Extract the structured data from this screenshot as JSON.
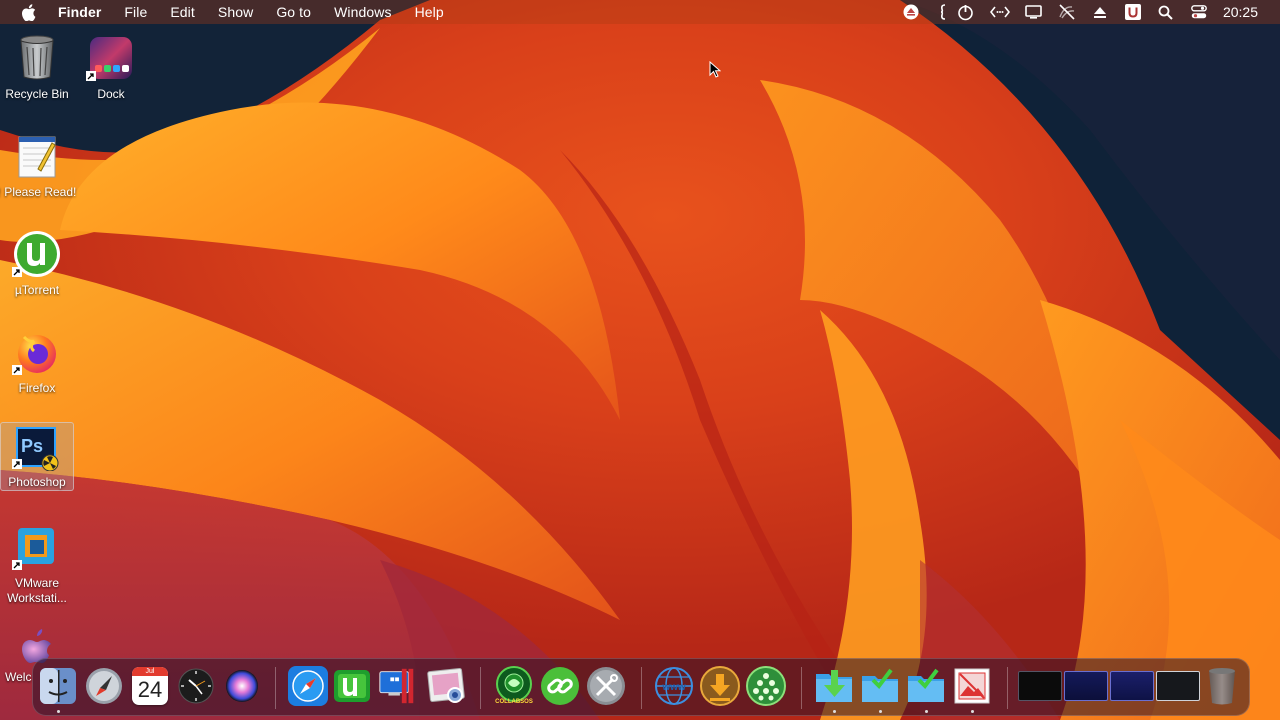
{
  "menubar": {
    "app_name": "Finder",
    "menus": [
      "File",
      "Edit",
      "Show",
      "Go to",
      "Windows",
      "Help"
    ],
    "status_icons": [
      "eject-circle-icon",
      "s-bracket-icon",
      "power-icon",
      "code-arrows-icon",
      "display-icon",
      "muted-icon",
      "eject-icon",
      "u-icon",
      "search-icon",
      "control-center-icon"
    ],
    "clock": "20:25"
  },
  "desktop": {
    "icons": [
      {
        "label": "Recycle Bin",
        "icon": "trash-icon"
      },
      {
        "label": "Dock",
        "icon": "dock-icon"
      },
      {
        "label": "! Please Read!",
        "icon": "notepad-icon"
      },
      {
        "label": "µTorrent",
        "icon": "utorrent-icon"
      },
      {
        "label": "Firefox",
        "icon": "firefox-icon"
      },
      {
        "label": "Photoshop",
        "icon": "photoshop-icon"
      },
      {
        "label": "VMware Workstati...",
        "icon": "vmware-icon"
      },
      {
        "label": "Welc",
        "icon": "apple-welcome-icon"
      }
    ],
    "selected": "Photoshop"
  },
  "dock": {
    "items": [
      "finder-icon",
      "launchpad-icon",
      "calendar-icon",
      "clock-icon",
      "siri-icon",
      "safari-icon",
      "utorrent-icon",
      "parallels-icon",
      "preview-icon",
      "collabsos-icon",
      "link-icon",
      "tools-icon",
      "www-icon",
      "download-icon",
      "cluster-icon",
      "downloads-folder-icon",
      "folder-check-icon",
      "folder-check-2-icon",
      "image-icon",
      "window-thumb-1",
      "window-thumb-2",
      "window-thumb-3",
      "window-thumb-4",
      "trash-icon"
    ],
    "calendar": {
      "month": "Jul",
      "day": "24"
    },
    "collabsos_text": "COLLABSOS"
  },
  "colors": {
    "wallpaper_orange": "#ff8a1a",
    "wallpaper_red": "#d3301a",
    "wallpaper_navy": "#0f2238",
    "menubar_text": "#ffffff"
  }
}
